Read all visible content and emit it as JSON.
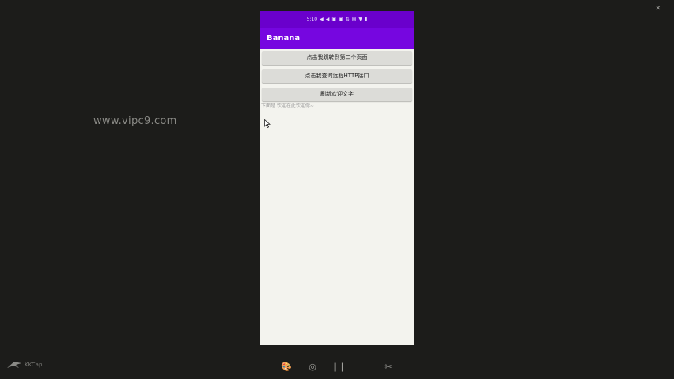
{
  "watermark": "www.vipc9.com",
  "phone": {
    "status_bar": {
      "items": [
        "5:10",
        "◀",
        "◀",
        "▣",
        "▣",
        "⇅",
        "▤",
        "▼",
        "▮"
      ]
    },
    "app_bar": {
      "title": "Banana"
    },
    "buttons": [
      {
        "label": "点击我跳转到第二个页面"
      },
      {
        "label": "点击我查询远程HTTP接口"
      },
      {
        "label": "刷新欢迎文字"
      }
    ],
    "welcome_text": "下面是 欢迎在此欢迎你~"
  },
  "player": {
    "controls": [
      {
        "icon": "paint-icon",
        "glyph": "🎨"
      },
      {
        "icon": "target-icon",
        "glyph": "◎"
      },
      {
        "icon": "pause-icon",
        "glyph": "❙❙"
      },
      {
        "icon": "scissors-icon",
        "glyph": "✂"
      }
    ],
    "logo": "KKCap"
  },
  "colors": {
    "status_bar": "#6a00cc",
    "app_bar": "#7606e0",
    "background": "#1c1c1a",
    "phone_bg": "#f3f3ee"
  }
}
